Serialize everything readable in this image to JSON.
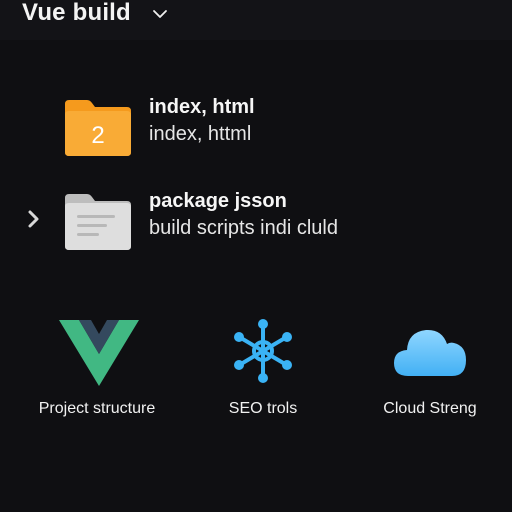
{
  "header": {
    "title": "Vue build"
  },
  "files": [
    {
      "name": "index, html",
      "subtitle": "index, httml",
      "badge": "2",
      "icon": "folder-icon",
      "color": "#f7a32a"
    },
    {
      "name": "package jsson",
      "subtitle": "build scripts indi cluld",
      "icon": "folder-document-icon",
      "color": "#d8d8d8"
    }
  ],
  "features": [
    {
      "label": "Project structure",
      "icon": "vue-logo-icon"
    },
    {
      "label": "SEO trols",
      "icon": "network-hub-icon"
    },
    {
      "label": "Cloud Streng",
      "icon": "cloud-icon"
    }
  ],
  "colors": {
    "background": "#0f0f12",
    "vue_green": "#41b883",
    "vue_dark": "#34495e",
    "accent_blue": "#3ab3f5"
  }
}
